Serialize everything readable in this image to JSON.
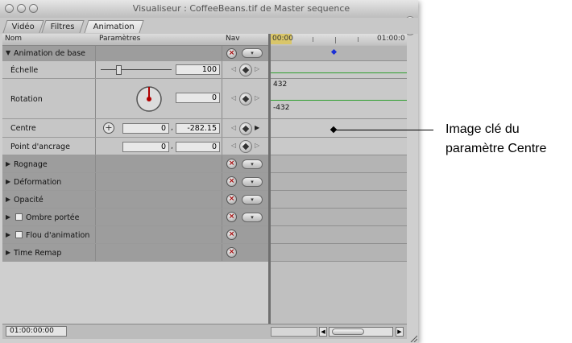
{
  "window": {
    "title": "Visualiseur : CoffeeBeans.tif de Master sequence",
    "tabs": [
      {
        "label": "Vidéo"
      },
      {
        "label": "Filtres"
      },
      {
        "label": "Animation",
        "active": true
      }
    ]
  },
  "header": {
    "name": "Nom",
    "params": "Paramètres",
    "nav": "Nav",
    "ruler_start": "00:00",
    "ruler_mid": "01:00:0"
  },
  "rows": {
    "basic_motion": {
      "label": "Animation de base"
    },
    "scale": {
      "label": "Échelle",
      "value": "100"
    },
    "rotation": {
      "label": "Rotation",
      "value": "0",
      "max": "432",
      "min": "-432"
    },
    "center": {
      "label": "Centre",
      "x": "0",
      "y": "-282.15",
      "sep": ","
    },
    "anchor": {
      "label": "Point d'ancrage",
      "x": "0",
      "y": "0",
      "sep": ","
    },
    "crop": {
      "label": "Rognage"
    },
    "distort": {
      "label": "Déformation"
    },
    "opacity": {
      "label": "Opacité"
    },
    "drop_shadow": {
      "label": "Ombre portée"
    },
    "motion_blur": {
      "label": "Flou d'animation"
    },
    "time_remap": {
      "label": "Time Remap"
    }
  },
  "footer": {
    "timecode": "01:00:00:00"
  },
  "annotation": {
    "line1": "Image clé du",
    "line2": "paramètre Centre"
  },
  "colors": {
    "keyframe_blue": "#1a2fd6",
    "curve_green": "#2f9e2f"
  }
}
